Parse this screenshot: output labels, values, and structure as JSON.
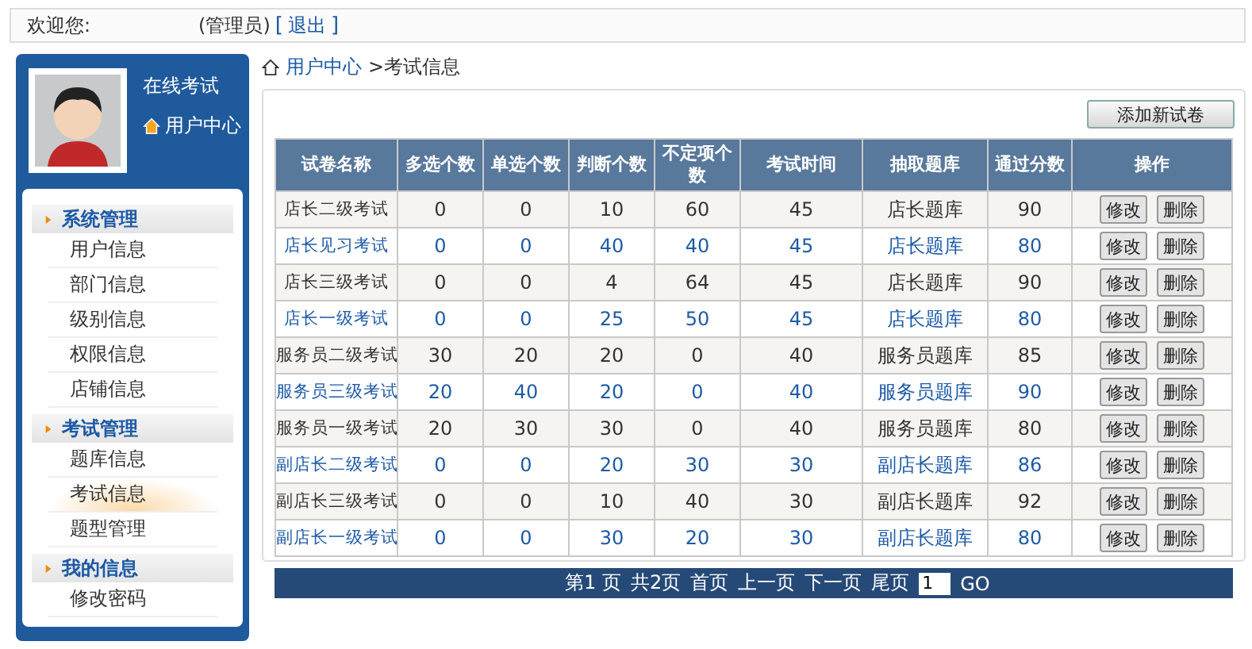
{
  "header": {
    "greeting": "欢迎您:",
    "role": "(管理员)",
    "logout_open": "[",
    "logout": "退出",
    "logout_close": "]"
  },
  "sidebar": {
    "title": "在线考试",
    "home_link": "用户中心",
    "groups": [
      {
        "title": "系统管理",
        "items": [
          {
            "label": "用户信息",
            "selected": false
          },
          {
            "label": "部门信息",
            "selected": false
          },
          {
            "label": "级别信息",
            "selected": false
          },
          {
            "label": "权限信息",
            "selected": false
          },
          {
            "label": "店铺信息",
            "selected": false
          }
        ]
      },
      {
        "title": "考试管理",
        "items": [
          {
            "label": "题库信息",
            "selected": false
          },
          {
            "label": "考试信息",
            "selected": true
          },
          {
            "label": "题型管理",
            "selected": false
          }
        ]
      },
      {
        "title": "我的信息",
        "items": [
          {
            "label": "修改密码",
            "selected": false
          }
        ]
      }
    ]
  },
  "breadcrumb": {
    "home": "用户中心",
    "current": ">考试信息"
  },
  "add_button": "添加新试卷",
  "table": {
    "columns": [
      "试卷名称",
      "多选个数",
      "单选个数",
      "判断个数",
      "不定项个数",
      "考试时间",
      "抽取题库",
      "通过分数",
      "操作"
    ],
    "rows": [
      {
        "shaded": true,
        "cells": [
          "店长二级考试",
          "0",
          "0",
          "10",
          "60",
          "45",
          "店长题库",
          "90"
        ],
        "actions": [
          "修改",
          "删除"
        ]
      },
      {
        "shaded": false,
        "cells": [
          "店长见习考试",
          "0",
          "0",
          "40",
          "40",
          "45",
          "店长题库",
          "80"
        ],
        "actions": [
          "修改",
          "删除"
        ]
      },
      {
        "shaded": true,
        "cells": [
          "店长三级考试",
          "0",
          "0",
          "4",
          "64",
          "45",
          "店长题库",
          "90"
        ],
        "actions": [
          "修改",
          "删除"
        ]
      },
      {
        "shaded": false,
        "cells": [
          "店长一级考试",
          "0",
          "0",
          "25",
          "50",
          "45",
          "店长题库",
          "80"
        ],
        "actions": [
          "修改",
          "删除"
        ]
      },
      {
        "shaded": true,
        "cells": [
          "服务员二级考试",
          "30",
          "20",
          "20",
          "0",
          "40",
          "服务员题库",
          "85"
        ],
        "actions": [
          "修改",
          "删除"
        ]
      },
      {
        "shaded": false,
        "cells": [
          "服务员三级考试",
          "20",
          "40",
          "20",
          "0",
          "40",
          "服务员题库",
          "90"
        ],
        "actions": [
          "修改",
          "删除"
        ]
      },
      {
        "shaded": true,
        "cells": [
          "服务员一级考试",
          "20",
          "30",
          "30",
          "0",
          "40",
          "服务员题库",
          "80"
        ],
        "actions": [
          "修改",
          "删除"
        ]
      },
      {
        "shaded": false,
        "cells": [
          "副店长二级考试",
          "0",
          "0",
          "20",
          "30",
          "30",
          "副店长题库",
          "86"
        ],
        "actions": [
          "修改",
          "删除"
        ]
      },
      {
        "shaded": true,
        "cells": [
          "副店长三级考试",
          "0",
          "0",
          "10",
          "40",
          "30",
          "副店长题库",
          "92"
        ],
        "actions": [
          "修改",
          "删除"
        ]
      },
      {
        "shaded": false,
        "cells": [
          "副店长一级考试",
          "0",
          "0",
          "30",
          "20",
          "30",
          "副店长题库",
          "80"
        ],
        "actions": [
          "修改",
          "删除"
        ]
      }
    ]
  },
  "pagination": {
    "page": "第1 页",
    "total": "共2页",
    "links": [
      "首页",
      "上一页",
      "下一页",
      "尾页"
    ],
    "page_input": "1",
    "go": "GO"
  }
}
